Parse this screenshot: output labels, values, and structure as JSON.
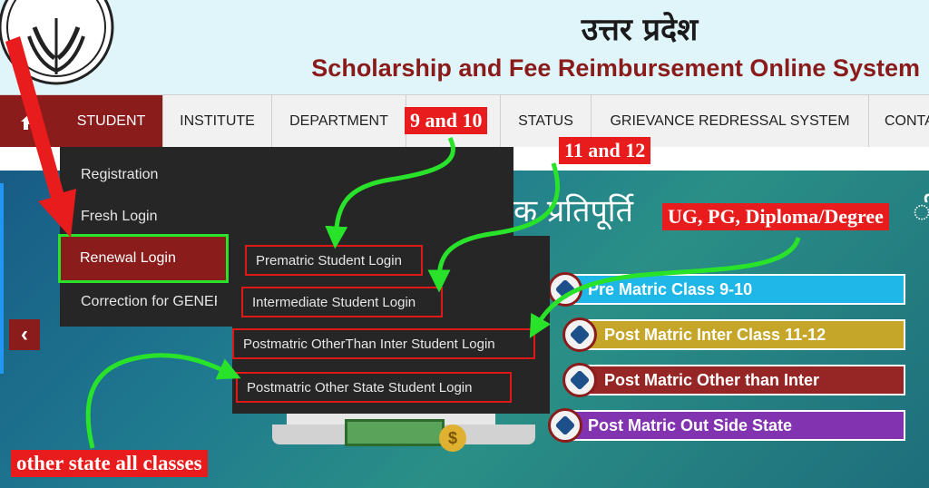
{
  "header": {
    "hindi_title": "उत्तर प्रदेश",
    "site_title": "Scholarship and Fee Reimbursement Online System"
  },
  "nav": {
    "home_icon": "home-icon",
    "items": [
      "STUDENT",
      "INSTITUTE",
      "DEPARTMENT",
      "",
      "STATUS",
      "GRIEVANCE REDRESSAL SYSTEM",
      "CONTA"
    ]
  },
  "student_menu": {
    "items": [
      "Registration",
      "Fresh Login",
      "Renewal Login",
      "Correction for GENERA"
    ]
  },
  "renewal_submenu": {
    "items": [
      "Prematric Student Login",
      "Intermediate Student Login",
      "Postmatric OtherThan Inter Student Login",
      "Postmatric Other State Student Login"
    ]
  },
  "banner": {
    "hindi_text": "क प्रतिपूर्ति",
    "hindi_text_end": "ी,",
    "slider_prev": "‹",
    "coin_symbol": "$",
    "rows": [
      "Pre Matric Class 9-10",
      "Post Matric Inter Class 11-12",
      "Post Matric Other than Inter",
      "Post Matric Out Side State"
    ]
  },
  "annotations": {
    "callout_9_10": "9 and 10",
    "callout_11_12": "11 and 12",
    "callout_ug_pg": "UG, PG, Diploma/Degree",
    "callout_other_state": "other state all classes"
  },
  "colors": {
    "brand_maroon": "#8b1c1c",
    "highlight_green": "#29e32b",
    "callout_red": "#e81c1c"
  }
}
